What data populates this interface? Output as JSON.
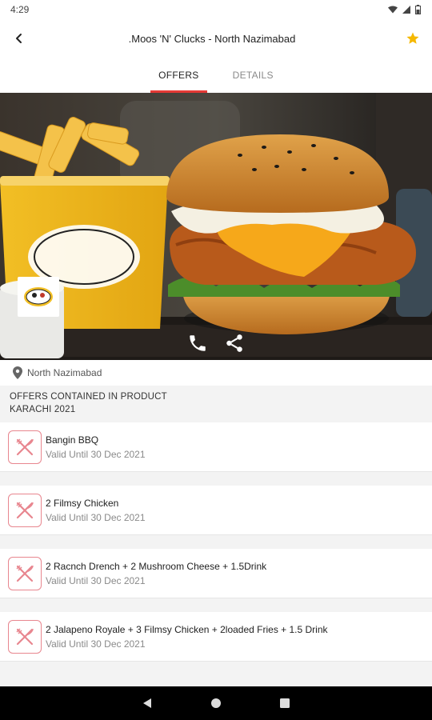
{
  "status_bar": {
    "time": "4:29"
  },
  "header": {
    "title": ".Moos 'N' Clucks - North Nazimabad"
  },
  "tabs": [
    {
      "label": "OFFERS",
      "active": true
    },
    {
      "label": "DETAILS",
      "active": false
    }
  ],
  "hero": {
    "logo_text": "Moos 'n' Clucks",
    "actions": [
      "phone-icon",
      "share-icon"
    ]
  },
  "location": {
    "label": "North Nazimabad"
  },
  "offers_section": {
    "line1": "OFFERS CONTAINED IN PRODUCT",
    "line2": "KARACHI 2021"
  },
  "offers": [
    {
      "title": "Bangin BBQ",
      "valid": "Valid Until 30 Dec 2021"
    },
    {
      "title": "2 Filmsy Chicken",
      "valid": "Valid Until 30 Dec 2021"
    },
    {
      "title": "2 Racnch Drench + 2 Mushroom Cheese + 1.5Drink",
      "valid": "Valid Until 30 Dec 2021"
    },
    {
      "title": "2 Jalapeno Royale + 3 Filmsy Chicken + 2loaded Fries + 1.5 Drink",
      "valid": "Valid Until 30 Dec 2021"
    }
  ],
  "colors": {
    "accent": "#e53935",
    "star": "#f5b800",
    "icon_border": "#e8868f"
  }
}
